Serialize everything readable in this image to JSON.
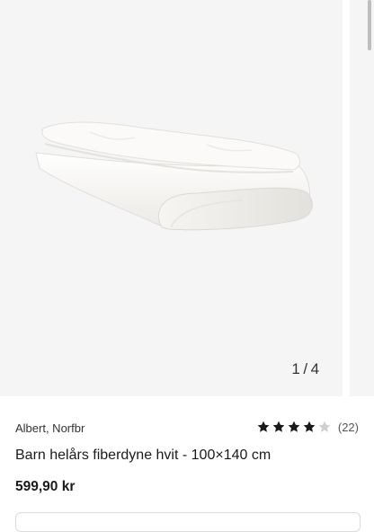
{
  "gallery": {
    "image_alt": "Barn helårs fiberdyne hvit",
    "counter_current": "1",
    "counter_separator": "/",
    "counter_total": "4"
  },
  "product": {
    "seller": "Albert, Norfbr",
    "title": "Barn helårs fiberdyne hvit - 100×140 cm",
    "price": "599,90 kr",
    "rating": {
      "value": 4,
      "max": 5,
      "review_count": "(22)",
      "filled_color": "#1a1a1a",
      "empty_color": "#d0d0d0",
      "icon": "star-icon"
    }
  }
}
